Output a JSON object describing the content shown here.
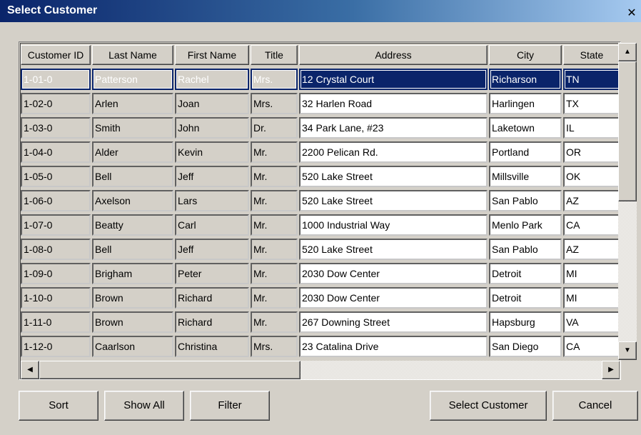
{
  "window": {
    "title": "Select Customer",
    "close_glyph": "✕"
  },
  "table": {
    "columns": [
      "Customer ID",
      "Last Name",
      "First Name",
      "Title",
      "Address",
      "City",
      "State"
    ],
    "rows": [
      [
        "1-01-0",
        "Patterson",
        "Rachel",
        "Mrs.",
        "12 Crystal Court",
        "Richarson",
        "TN"
      ],
      [
        "1-02-0",
        "Arlen",
        "Joan",
        "Mrs.",
        "32 Harlen Road",
        "Harlingen",
        "TX"
      ],
      [
        "1-03-0",
        "Smith",
        "John",
        "Dr.",
        "34 Park Lane, #23",
        "Laketown",
        "IL"
      ],
      [
        "1-04-0",
        "Alder",
        "Kevin",
        "Mr.",
        "2200 Pelican Rd.",
        "Portland",
        "OR"
      ],
      [
        "1-05-0",
        "Bell",
        "Jeff",
        "Mr.",
        "520 Lake Street",
        "Millsville",
        "OK"
      ],
      [
        "1-06-0",
        "Axelson",
        "Lars",
        "Mr.",
        "520 Lake Street",
        "San Pablo",
        "AZ"
      ],
      [
        "1-07-0",
        "Beatty",
        "Carl",
        "Mr.",
        "1000 Industrial Way",
        "Menlo Park",
        "CA"
      ],
      [
        "1-08-0",
        "Bell",
        "Jeff",
        "Mr.",
        "520 Lake Street",
        "San Pablo",
        "AZ"
      ],
      [
        "1-09-0",
        "Brigham",
        "Peter",
        "Mr.",
        "2030 Dow Center",
        "Detroit",
        "MI"
      ],
      [
        "1-10-0",
        "Brown",
        "Richard",
        "Mr.",
        "2030 Dow Center",
        "Detroit",
        "MI"
      ],
      [
        "1-11-0",
        "Brown",
        "Richard",
        "Mr.",
        "267 Downing Street",
        "Hapsburg",
        "VA"
      ],
      [
        "1-12-0",
        "Caarlson",
        "Christina",
        "Mrs.",
        "23 Catalina Drive",
        "San Diego",
        "CA"
      ]
    ],
    "selected_row": 0
  },
  "buttons": {
    "sort": "Sort",
    "show_all": "Show All",
    "filter": "Filter",
    "select_customer": "Select Customer",
    "cancel": "Cancel"
  },
  "icons": {
    "close": "close-icon",
    "scroll_up": "arrow-up-icon",
    "scroll_down": "arrow-down-icon",
    "scroll_left": "arrow-left-icon",
    "scroll_right": "arrow-right-icon"
  },
  "colors": {
    "selection": "#0a246a",
    "face": "#d4d0c8"
  }
}
